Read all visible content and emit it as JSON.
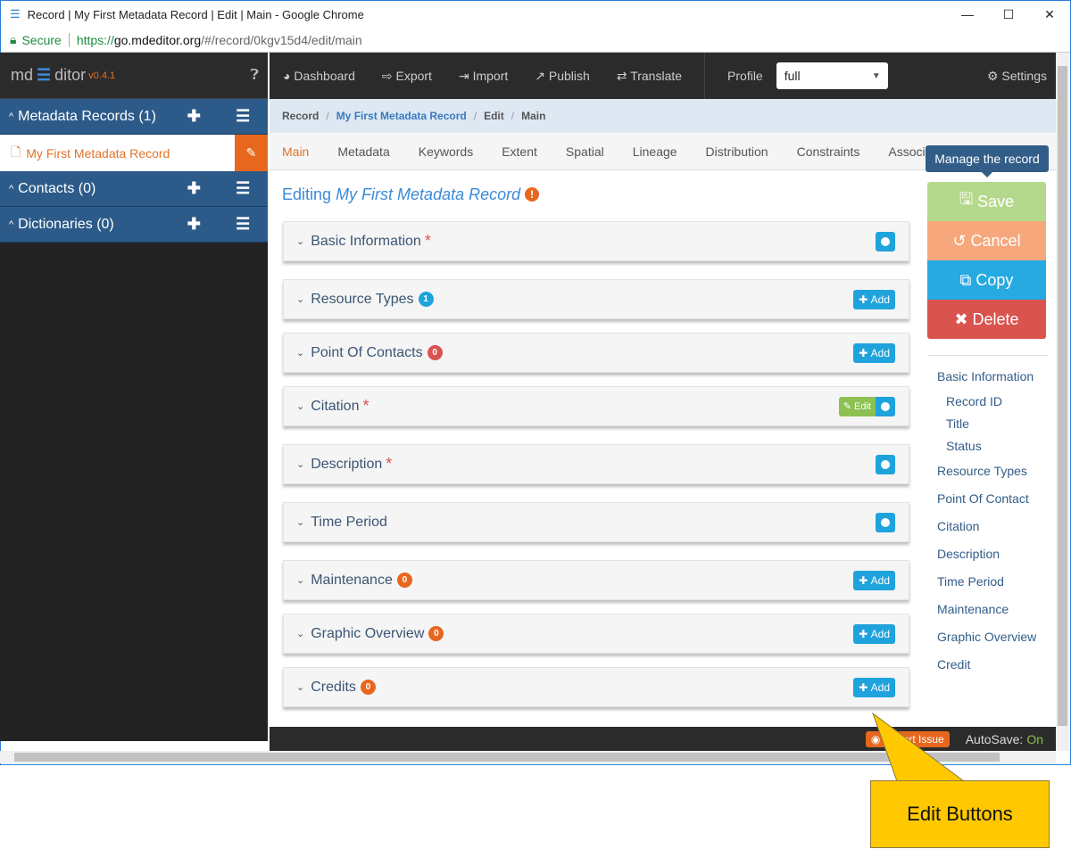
{
  "browser": {
    "title": "Record | My First Metadata Record | Edit | Main - Google Chrome",
    "secure": "Secure",
    "url_host": "https://",
    "url_domain": "go.mdeditor.org",
    "url_path": "/#/record/0kgv15d4/edit/main"
  },
  "logo": {
    "left": "md",
    "right": "ditor",
    "version": "v0.4.1"
  },
  "sidebar": {
    "groups": [
      {
        "label": "Metadata Records (1)"
      },
      {
        "label": "Contacts (0)"
      },
      {
        "label": "Dictionaries (0)"
      }
    ],
    "record_item": "My First Metadata Record"
  },
  "nav": {
    "items": [
      "Dashboard",
      "Export",
      "Import",
      "Publish",
      "Translate"
    ],
    "profile_label": "Profile",
    "profile_value": "full",
    "settings": "Settings"
  },
  "breadcrumb": [
    "Record",
    "My First Metadata Record",
    "Edit",
    "Main"
  ],
  "tabs": [
    "Main",
    "Metadata",
    "Keywords",
    "Extent",
    "Spatial",
    "Lineage",
    "Distribution",
    "Constraints",
    "Associ"
  ],
  "editing": {
    "prefix": "Editing",
    "title": "My First Metadata Record",
    "warn": "!"
  },
  "panels": [
    {
      "label": "Basic Information",
      "required": true,
      "action": "dot"
    },
    {
      "label": "Resource Types",
      "badge": "1",
      "badge_color": "#1fa3dd",
      "action": "add"
    },
    {
      "label": "Point Of Contacts",
      "badge": "0",
      "badge_color": "#d9534f",
      "action": "add"
    },
    {
      "label": "Citation",
      "required": true,
      "action": "edit"
    },
    {
      "label": "Description",
      "required": true,
      "action": "dot"
    },
    {
      "label": "Time Period",
      "action": "dot"
    },
    {
      "label": "Maintenance",
      "badge": "0",
      "badge_color": "#e8671f",
      "action": "add"
    },
    {
      "label": "Graphic Overview",
      "badge": "0",
      "badge_color": "#e8671f",
      "action": "add"
    },
    {
      "label": "Credits",
      "badge": "0",
      "badge_color": "#e8671f",
      "action": "add"
    }
  ],
  "buttons": {
    "add": "Add",
    "edit": "Edit"
  },
  "record_actions": {
    "tooltip": "Manage the record",
    "save": "Save",
    "cancel": "Cancel",
    "copy": "Copy",
    "delete": "Delete"
  },
  "toc": [
    {
      "label": "Basic Information"
    },
    {
      "label": "Record ID",
      "sub": true
    },
    {
      "label": "Title",
      "sub": true
    },
    {
      "label": "Status",
      "sub": true
    },
    {
      "label": "Resource Types"
    },
    {
      "label": "Point Of Contact"
    },
    {
      "label": "Citation"
    },
    {
      "label": "Description"
    },
    {
      "label": "Time Period"
    },
    {
      "label": "Maintenance"
    },
    {
      "label": "Graphic Overview"
    },
    {
      "label": "Credit"
    }
  ],
  "footer": {
    "report": "Report Issue",
    "autosave": "AutoSave:",
    "autosave_state": "On"
  },
  "callout": "Edit Buttons"
}
